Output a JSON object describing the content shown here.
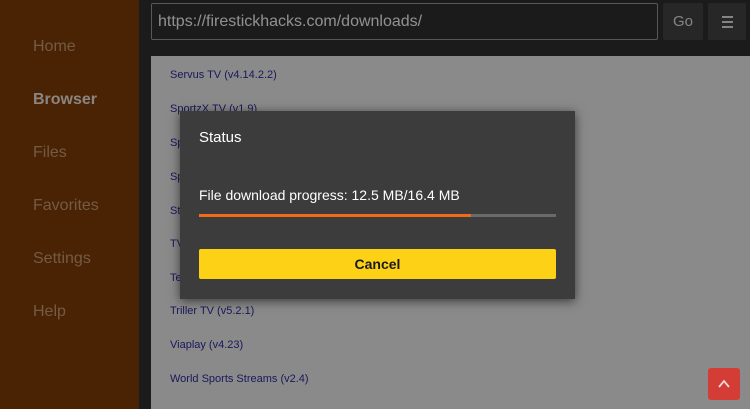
{
  "sidebar": {
    "items": [
      {
        "label": "Home"
      },
      {
        "label": "Browser"
      },
      {
        "label": "Files"
      },
      {
        "label": "Favorites"
      },
      {
        "label": "Settings"
      },
      {
        "label": "Help"
      }
    ]
  },
  "toolbar": {
    "url": "https://firestickhacks.com/downloads/",
    "go_label": "Go",
    "menu_icon": "hamburger-menu-icon"
  },
  "list": {
    "items": [
      {
        "label": "Servus TV (v4.14.2.2)"
      },
      {
        "label": "SportzX TV (v1.9)"
      },
      {
        "label": "Sp"
      },
      {
        "label": "Sp"
      },
      {
        "label": "St"
      },
      {
        "label": "TV"
      },
      {
        "label": "Te"
      },
      {
        "label": "Triller TV (v5.2.1)"
      },
      {
        "label": "Viaplay (v4.23)"
      },
      {
        "label": "World Sports Streams (v2.4)"
      }
    ]
  },
  "dialog": {
    "title": "Status",
    "progress_text": "File download progress: 12.5 MB/16.4 MB",
    "progress_fraction": 0.762,
    "cancel_label": "Cancel"
  },
  "scroll_top": {
    "icon": "chevron-up-icon"
  },
  "colors": {
    "sidebar": "#723707",
    "accent_yellow": "#fdd116",
    "progress_orange": "#f26a1b",
    "scroll_button": "#d43d35",
    "link": "#2a2891"
  }
}
